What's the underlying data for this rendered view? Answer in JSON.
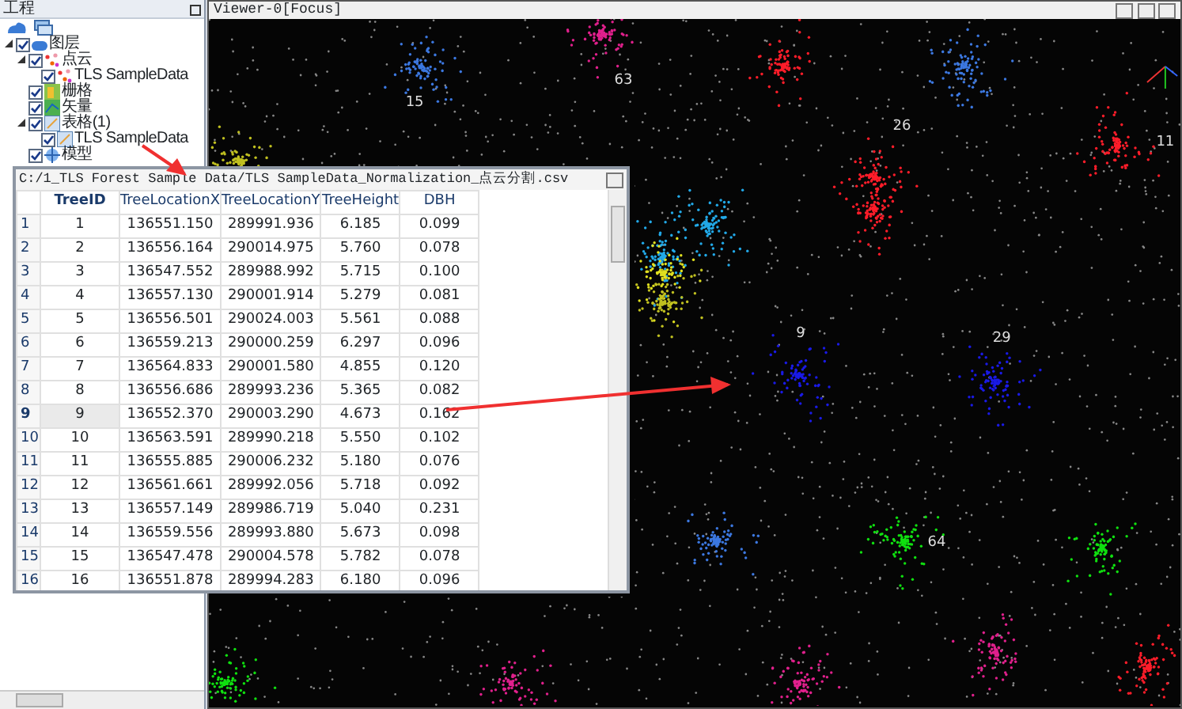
{
  "project_panel": {
    "title": "工程",
    "tree": [
      {
        "label": "图层",
        "checked": true,
        "expanded": true,
        "kind": "layers",
        "children": [
          {
            "label": "点云",
            "checked": true,
            "expanded": true,
            "kind": "points",
            "children": [
              {
                "label": "TLS SampleData",
                "checked": true,
                "kind": "points"
              }
            ]
          },
          {
            "label": "栅格",
            "checked": true,
            "kind": "raster"
          },
          {
            "label": "矢量",
            "checked": true,
            "kind": "vector"
          },
          {
            "label": "表格(1)",
            "checked": true,
            "expanded": true,
            "kind": "table",
            "children": [
              {
                "label": "TLS SampleData",
                "checked": true,
                "kind": "table"
              }
            ]
          },
          {
            "label": "模型",
            "checked": true,
            "kind": "model"
          }
        ]
      }
    ]
  },
  "viewer": {
    "title": "Viewer-0[Focus]",
    "tree_labels": [
      "15",
      "63",
      "26",
      "11",
      "9",
      "29",
      "64"
    ]
  },
  "table_window": {
    "title": "C:/1_TLS Forest Sample Data/TLS SampleData_Normalization_点云分割.csv",
    "columns": [
      "TreeID",
      "TreeLocationX",
      "TreeLocationY",
      "TreeHeight",
      "DBH"
    ],
    "rows": [
      {
        "index": "1",
        "cells": [
          "1",
          "136551.150",
          "289991.936",
          "6.185",
          "0.099"
        ],
        "selected": false
      },
      {
        "index": "2",
        "cells": [
          "2",
          "136556.164",
          "290014.975",
          "5.760",
          "0.078"
        ],
        "selected": false
      },
      {
        "index": "3",
        "cells": [
          "3",
          "136547.552",
          "289988.992",
          "5.715",
          "0.100"
        ],
        "selected": false
      },
      {
        "index": "4",
        "cells": [
          "4",
          "136557.130",
          "290001.914",
          "5.279",
          "0.081"
        ],
        "selected": false
      },
      {
        "index": "5",
        "cells": [
          "5",
          "136556.501",
          "290024.003",
          "5.561",
          "0.088"
        ],
        "selected": false
      },
      {
        "index": "6",
        "cells": [
          "6",
          "136559.213",
          "290000.259",
          "6.297",
          "0.096"
        ],
        "selected": false
      },
      {
        "index": "7",
        "cells": [
          "7",
          "136564.833",
          "290001.580",
          "4.855",
          "0.120"
        ],
        "selected": false
      },
      {
        "index": "8",
        "cells": [
          "8",
          "136556.686",
          "289993.236",
          "5.365",
          "0.082"
        ],
        "selected": false
      },
      {
        "index": "9",
        "cells": [
          "9",
          "136552.370",
          "290003.290",
          "4.673",
          "0.162"
        ],
        "selected": true
      },
      {
        "index": "10",
        "cells": [
          "10",
          "136563.591",
          "289990.218",
          "5.550",
          "0.102"
        ],
        "selected": false
      },
      {
        "index": "11",
        "cells": [
          "11",
          "136555.885",
          "290006.232",
          "5.180",
          "0.076"
        ],
        "selected": false
      },
      {
        "index": "12",
        "cells": [
          "12",
          "136561.661",
          "289992.056",
          "5.718",
          "0.092"
        ],
        "selected": false
      },
      {
        "index": "13",
        "cells": [
          "13",
          "136557.149",
          "289986.719",
          "5.040",
          "0.231"
        ],
        "selected": false
      },
      {
        "index": "14",
        "cells": [
          "14",
          "136559.556",
          "289993.880",
          "5.673",
          "0.098"
        ],
        "selected": false
      },
      {
        "index": "15",
        "cells": [
          "15",
          "136547.478",
          "290004.578",
          "5.782",
          "0.078"
        ],
        "selected": false
      },
      {
        "index": "16",
        "cells": [
          "16",
          "136551.878",
          "289994.283",
          "6.180",
          "0.096"
        ],
        "selected": false
      }
    ]
  }
}
